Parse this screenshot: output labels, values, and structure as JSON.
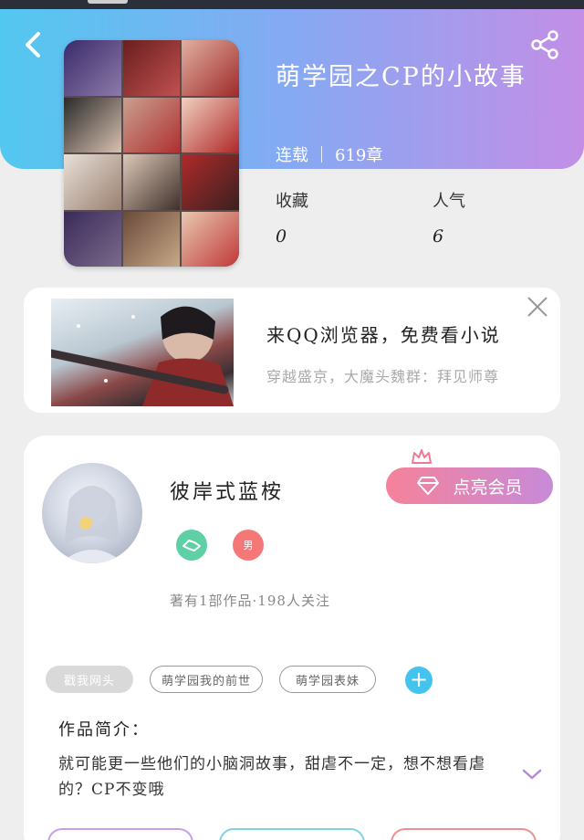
{
  "header": {
    "book_title": "萌学园之CP的小故事",
    "status": "连载",
    "chapters": "619章"
  },
  "stats": {
    "favorites_label": "收藏",
    "favorites_value": "0",
    "popularity_label": "人气",
    "popularity_value": "6"
  },
  "ad": {
    "title": "来QQ浏览器，免费看小说",
    "subtitle": "穿越盛京，大魔头魏群：拜见师尊"
  },
  "author": {
    "name": "彼岸式蓝桉",
    "vip_label": "点亮会员",
    "badge_red_text": "男",
    "stats_line": "著有1部作品·198人关注"
  },
  "tags": [
    {
      "label": "戳我网头"
    },
    {
      "label": "萌学园我的前世"
    },
    {
      "label": "萌学园表妹"
    }
  ],
  "intro": {
    "label": "作品简介：",
    "text": "就可能更一些他们的小脑洞故事，甜虐不一定，想不想看虐的？CP不变哦"
  },
  "colors": {
    "header_start": "#52c8f0",
    "header_end": "#c38ee6",
    "vip_start": "#f5829a",
    "vip_end": "#c78ad9",
    "add_tag": "#44c3ef"
  },
  "icons": [
    "back-arrow-icon",
    "share-icon",
    "close-icon",
    "diamond-icon",
    "crown-icon",
    "handshake-icon",
    "plus-icon",
    "chevron-down-icon"
  ]
}
